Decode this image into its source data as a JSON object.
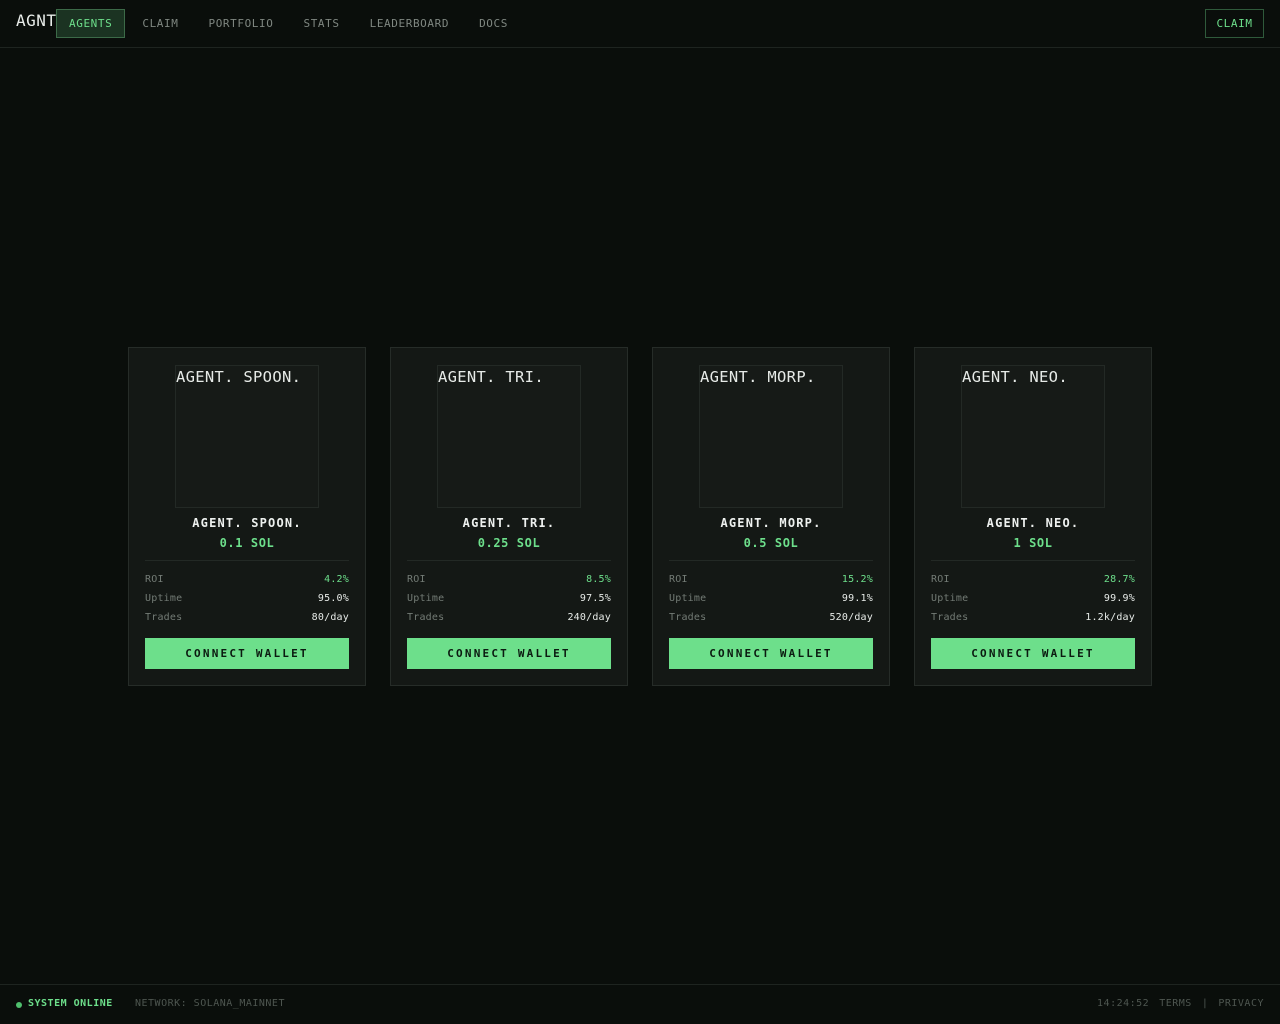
{
  "header": {
    "logo": "AGNT",
    "nav": [
      {
        "label": "AGENTS",
        "active": true
      },
      {
        "label": "CLAIM",
        "active": false
      },
      {
        "label": "PORTFOLIO",
        "active": false
      },
      {
        "label": "STATS",
        "active": false
      },
      {
        "label": "LEADERBOARD",
        "active": false
      },
      {
        "label": "DOCS",
        "active": false
      }
    ],
    "claim_label": "CLAIM"
  },
  "cards": [
    {
      "avatar_text": "AGENT. SPOON.",
      "name": "AGENT. SPOON.",
      "price": "0.1 SOL",
      "stats": [
        {
          "label": "ROI",
          "value": "4.2%",
          "green": true
        },
        {
          "label": "Uptime",
          "value": "95.0%",
          "green": false
        },
        {
          "label": "Trades",
          "value": "80/day",
          "green": false
        }
      ],
      "button": "CONNECT WALLET"
    },
    {
      "avatar_text": "AGENT. TRI.",
      "name": "AGENT. TRI.",
      "price": "0.25 SOL",
      "stats": [
        {
          "label": "ROI",
          "value": "8.5%",
          "green": true
        },
        {
          "label": "Uptime",
          "value": "97.5%",
          "green": false
        },
        {
          "label": "Trades",
          "value": "240/day",
          "green": false
        }
      ],
      "button": "CONNECT WALLET"
    },
    {
      "avatar_text": "AGENT. MORP.",
      "name": "AGENT. MORP.",
      "price": "0.5 SOL",
      "stats": [
        {
          "label": "ROI",
          "value": "15.2%",
          "green": true
        },
        {
          "label": "Uptime",
          "value": "99.1%",
          "green": false
        },
        {
          "label": "Trades",
          "value": "520/day",
          "green": false
        }
      ],
      "button": "CONNECT WALLET"
    },
    {
      "avatar_text": "AGENT. NEO.",
      "name": "AGENT. NEO.",
      "price": "1 SOL",
      "stats": [
        {
          "label": "ROI",
          "value": "28.7%",
          "green": true
        },
        {
          "label": "Uptime",
          "value": "99.9%",
          "green": false
        },
        {
          "label": "Trades",
          "value": "1.2k/day",
          "green": false
        }
      ],
      "button": "CONNECT WALLET"
    }
  ],
  "footer": {
    "status": "SYSTEM ONLINE",
    "network": "NETWORK: SOLANA_MAINNET",
    "time": "14:24:52",
    "terms": "TERMS",
    "separator": "|",
    "privacy": "PRIVACY"
  },
  "colors": {
    "accent": "#6ddf8b",
    "background": "#0a0e0b",
    "card": "#141815"
  }
}
